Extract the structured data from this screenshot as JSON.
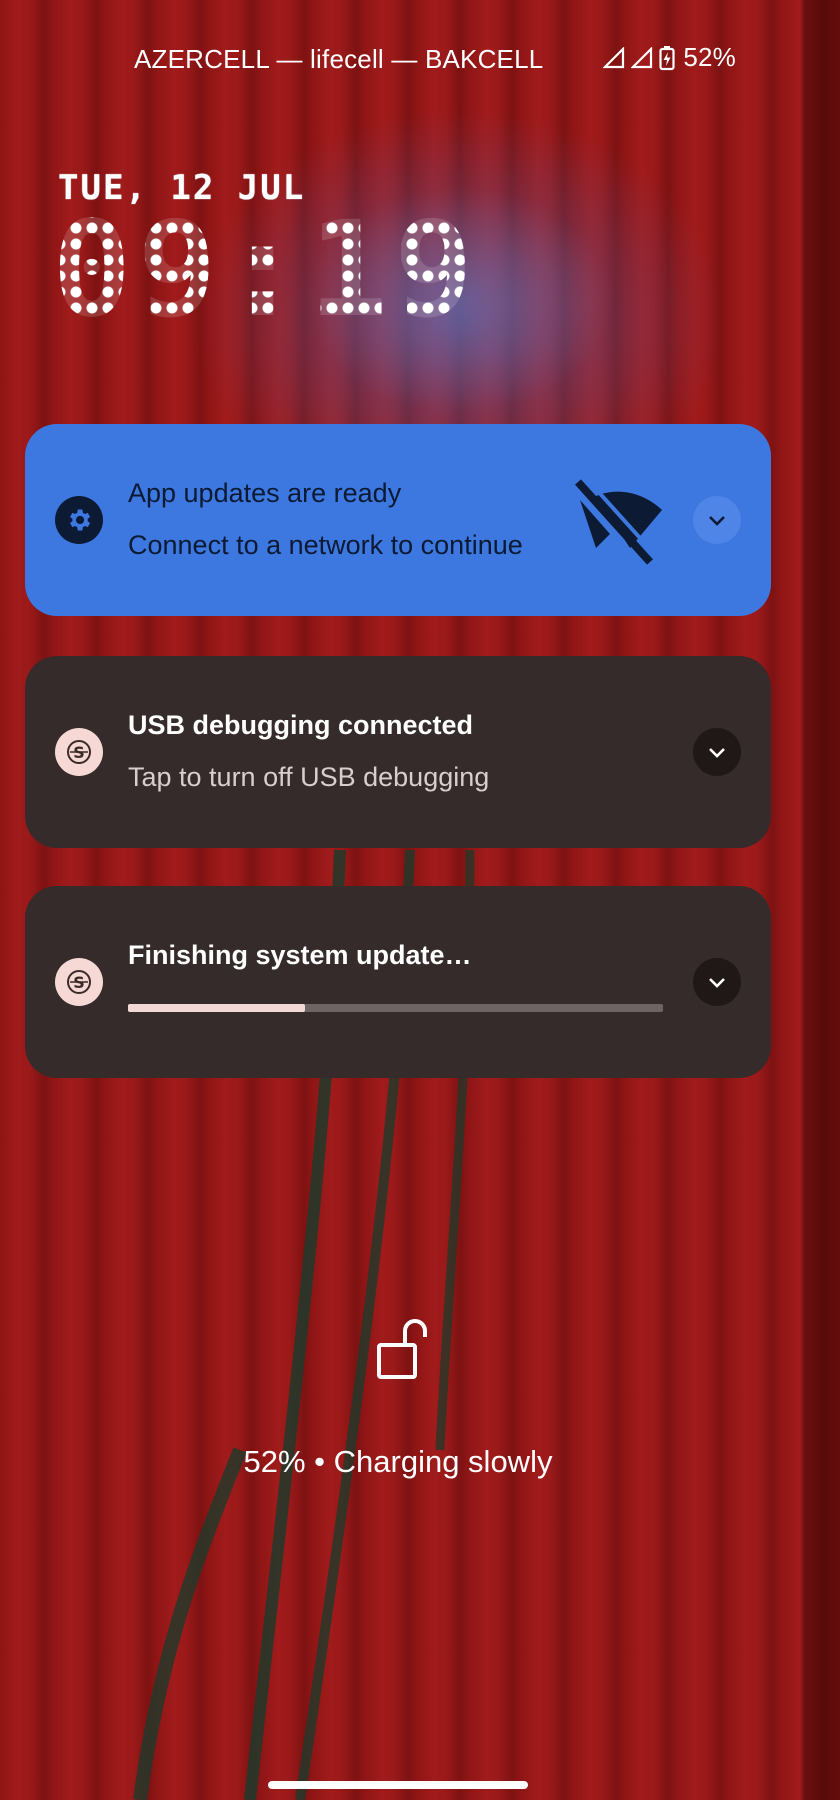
{
  "status_bar": {
    "carriers": "AZERCELL — lifecell — BAKCELL",
    "battery": "52%",
    "icons": [
      "signal-icon",
      "signal-icon",
      "battery-charging-icon"
    ]
  },
  "lockscreen": {
    "date": "TUE, 12 JUL",
    "time": "09:19"
  },
  "notifications": [
    {
      "title": "App updates are ready",
      "subtitle": "Connect to a network to continue",
      "icon": "gear-icon",
      "large_icon": "wifi-off-icon",
      "color": "#3c78e0"
    },
    {
      "title": "USB debugging connected",
      "subtitle": "Tap to turn off USB debugging",
      "icon": "system-icon",
      "color": "#342b2a"
    },
    {
      "title": "Finishing system update…",
      "icon": "system-icon",
      "progress": 0.33,
      "color": "#342b2a"
    }
  ],
  "bottom": {
    "lock_icon": "unlocked-padlock-icon",
    "charging_text": "52% • Charging slowly"
  },
  "colors": {
    "wallpaper": "#8e1515",
    "accent_blue": "#3c78e0",
    "card_dark": "#342b2a"
  }
}
